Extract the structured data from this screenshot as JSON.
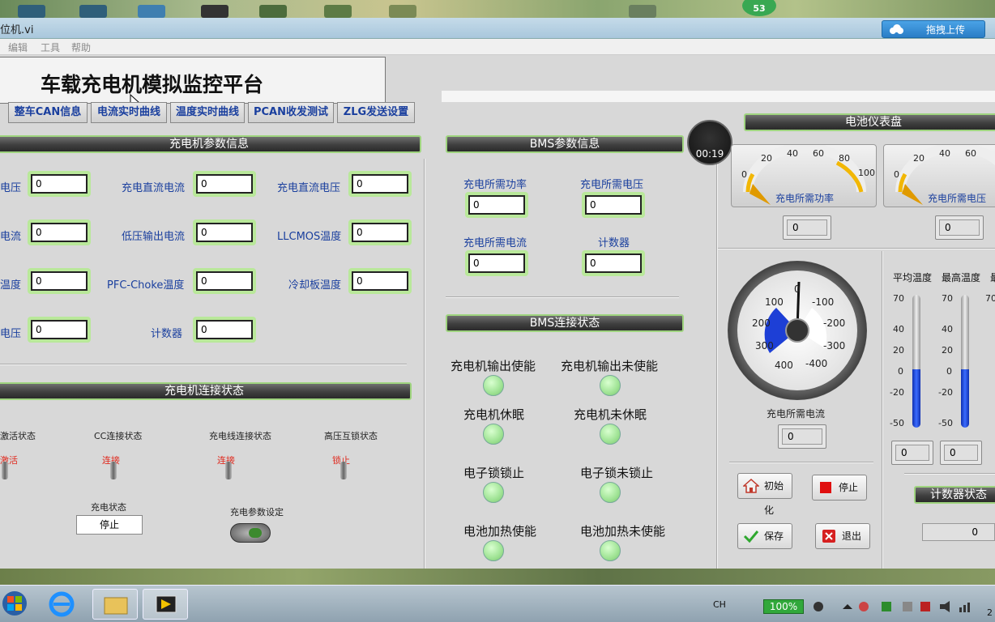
{
  "window": {
    "title": "位机.vi",
    "upload_label": "拖拽上传",
    "notif_count": "53"
  },
  "menu": [
    "编辑",
    "工具",
    "帮助"
  ],
  "app_title": "车载充电机模拟监控平台",
  "tabs": [
    "整车CAN信息",
    "电流实时曲线",
    "温度实时曲线",
    "PCAN收发测试",
    "ZLG发送设置"
  ],
  "charger": {
    "header": "充电机参数信息",
    "fields": [
      {
        "label": "电压",
        "value": "0"
      },
      {
        "label": "充电直流电流",
        "value": "0"
      },
      {
        "label": "充电直流电压",
        "value": "0"
      },
      {
        "label": "电流",
        "value": "0"
      },
      {
        "label": "低压输出电流",
        "value": "0"
      },
      {
        "label": "LLCMOS温度",
        "value": "0"
      },
      {
        "label": "温度",
        "value": "0"
      },
      {
        "label": "PFC-Choke温度",
        "value": "0"
      },
      {
        "label": "冷却板温度",
        "value": "0"
      },
      {
        "label": "电压",
        "value": "0"
      },
      {
        "label": "计数器",
        "value": "0"
      }
    ]
  },
  "charger_conn": {
    "header": "充电机连接状态",
    "switches": [
      {
        "label": "激活状态",
        "state": "激活"
      },
      {
        "label": "CC连接状态",
        "state": "连接"
      },
      {
        "label": "充电线连接状态",
        "state": "连接"
      },
      {
        "label": "高压互锁状态",
        "state": "锁止"
      }
    ],
    "charge_status_label": "充电状态",
    "charge_status_value": "停止",
    "param_setting_label": "充电参数设定"
  },
  "bms": {
    "header": "BMS参数信息",
    "fields": [
      {
        "label": "充电所需功率",
        "value": "0"
      },
      {
        "label": "充电所需电压",
        "value": "0"
      },
      {
        "label": "充电所需电流",
        "value": "0"
      },
      {
        "label": "计数器",
        "value": "0"
      }
    ]
  },
  "bms_conn": {
    "header": "BMS连接状态",
    "leds": [
      "充电机输出使能",
      "充电机输出未使能",
      "充电机休眠",
      "充电机未休眠",
      "电子锁锁止",
      "电子锁未锁止",
      "电池加热使能",
      "电池加热未使能"
    ]
  },
  "timer": "00:19",
  "battery": {
    "header": "电池仪表盘",
    "gauge1": {
      "label": "充电所需功率",
      "ticks": [
        "0",
        "20",
        "40",
        "60",
        "80",
        "100"
      ],
      "value": "0"
    },
    "gauge2": {
      "label": "充电所需电压",
      "ticks": [
        "0",
        "20",
        "40",
        "60"
      ],
      "value": "0"
    },
    "dial": {
      "label": "充电所需电流",
      "ticks": [
        "0",
        "-100",
        "-200",
        "-300",
        "-400",
        "400",
        "300",
        "200",
        "100"
      ],
      "value": "0"
    },
    "thermo_labels": [
      "平均温度",
      "最高温度",
      "最"
    ],
    "thermo_ticks": [
      "70",
      "40",
      "20",
      "0",
      "-20",
      "-50"
    ],
    "thermo_values": [
      "0",
      "0"
    ],
    "counter_header": "计数器状态",
    "counter_value": "0"
  },
  "buttons": {
    "init": "初始化",
    "stop": "停止",
    "save": "保存",
    "exit": "退出"
  },
  "taskbar": {
    "lang": "CH",
    "battery": "100%",
    "clock": "2"
  },
  "colors": {
    "accent_green": "#9fd47f",
    "label_blue": "#1a3f9e",
    "toggle_red": "#e0281c"
  }
}
